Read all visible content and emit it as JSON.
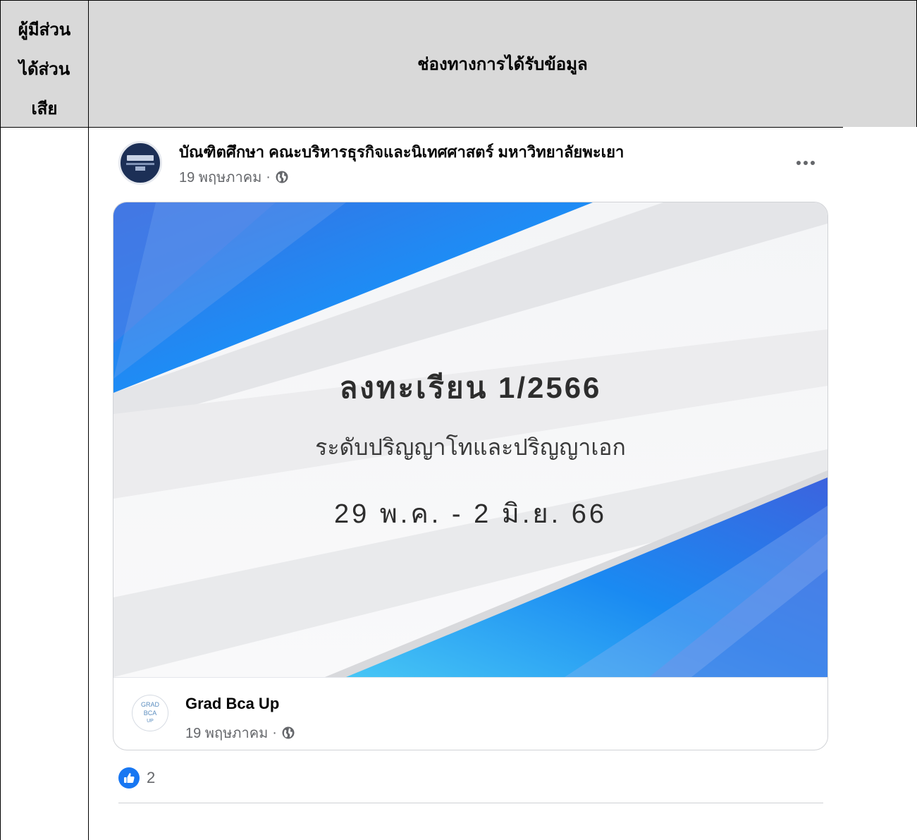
{
  "table": {
    "col1_header_lines": [
      "ผู้มีส่วน",
      "ได้ส่วน",
      "เสีย"
    ],
    "col2_header": "ช่องทางการได้รับข้อมูล"
  },
  "post": {
    "page_name": "บัณฑิตศึกษา คณะบริหารธุรกิจและนิเทศศาสตร์ มหาวิทยาลัยพะเยา",
    "date": "19 พฤษภาคม",
    "separator": "·",
    "banner": {
      "title": "ลงทะเรียน 1/2566",
      "subtitle": "ระดับปริญญาโทและปริญญาเอก",
      "dates": "29 พ.ค. - 2 มิ.ย. 66",
      "accent_color": "#1877f2"
    },
    "shared_from": {
      "name": "Grad Bca Up",
      "avatar_lines": [
        "GRAD",
        "BCA",
        "UP"
      ],
      "date": "19 พฤษภาคม",
      "separator": "·"
    },
    "reactions": {
      "icon": "like-icon",
      "count": "2"
    }
  },
  "icons": {
    "privacy": "globe-icon",
    "menu": "more-options-icon"
  }
}
